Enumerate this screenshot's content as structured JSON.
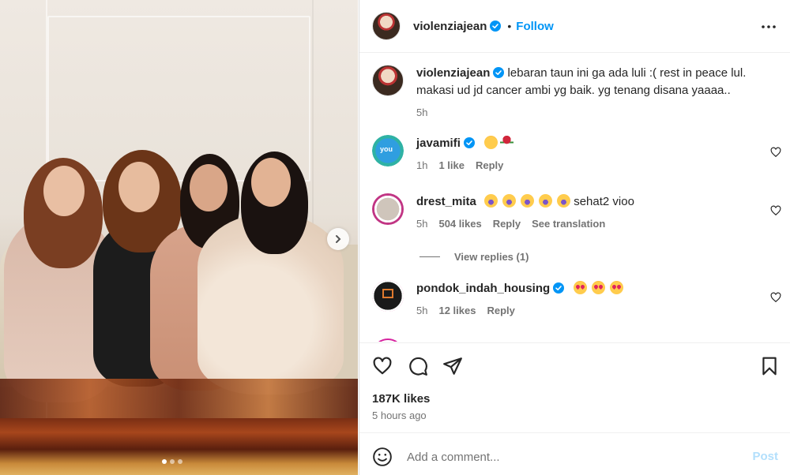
{
  "post": {
    "author": "violenziajean",
    "follow_label": "Follow",
    "separator": "•",
    "caption": "lebaran taun ini ga ada luli :( rest in peace lul. makasi ud jd cancer ambi yg baik. yg tenang disana yaaaa..",
    "caption_time": "5h",
    "likes": "187K likes",
    "posted_ago": "5 hours ago"
  },
  "comments": [
    {
      "user": "javamifi",
      "verified": true,
      "emojis": [
        "flushed-face",
        "rose"
      ],
      "text": "",
      "time": "1h",
      "likes": "1 like",
      "reply": "Reply"
    },
    {
      "user": "drest_mita",
      "verified": false,
      "emojis": [
        "screaming-face",
        "screaming-face",
        "screaming-face",
        "screaming-face",
        "screaming-face"
      ],
      "text": "sehat2 vioo",
      "time": "5h",
      "likes": "504 likes",
      "reply": "Reply",
      "translate": "See translation"
    },
    {
      "user": "pondok_indah_housing",
      "verified": true,
      "emojis": [
        "heart-eyes",
        "heart-eyes",
        "heart-eyes"
      ],
      "text": "",
      "time": "5h",
      "likes": "12 likes",
      "reply": "Reply"
    }
  ],
  "view_replies": "View replies (1)",
  "add_comment": {
    "placeholder": "Add a comment...",
    "post_label": "Post"
  },
  "colors": {
    "link_blue": "#0095f6",
    "post_disabled": "#b2dffc",
    "muted": "#737373"
  },
  "carousel": {
    "slides": 3,
    "active": 1
  }
}
